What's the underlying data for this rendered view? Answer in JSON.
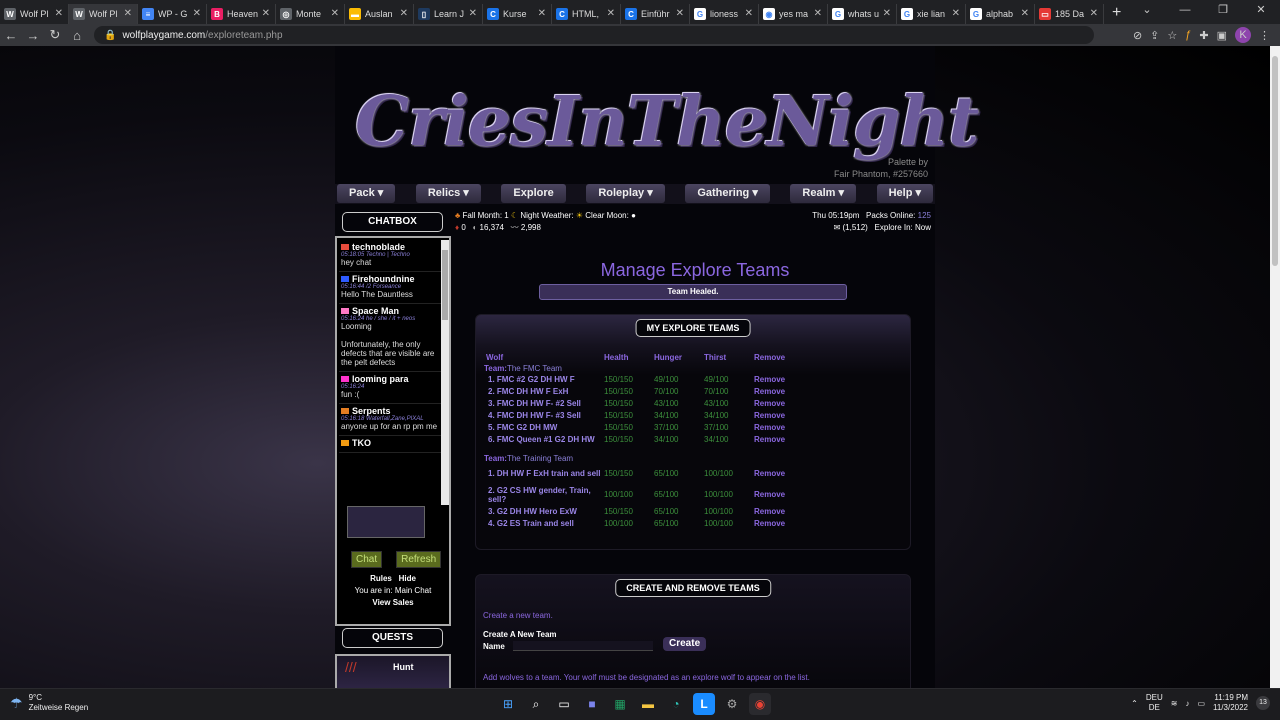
{
  "browser": {
    "tabs": [
      {
        "label": "Wolf Pl",
        "color": "#5f6368",
        "glyph": "W"
      },
      {
        "label": "Wolf Pl",
        "color": "#5f6368",
        "glyph": "W"
      },
      {
        "label": "WP - G",
        "color": "#4285f4",
        "glyph": "≡"
      },
      {
        "label": "Heaven",
        "color": "#e91e63",
        "glyph": "B"
      },
      {
        "label": "Monte",
        "color": "#5f6368",
        "glyph": "◎"
      },
      {
        "label": "Auslan",
        "color": "#fbbc04",
        "glyph": "▬"
      },
      {
        "label": "Learn J",
        "color": "#1e3a5f",
        "glyph": "▯"
      },
      {
        "label": "Kurse",
        "color": "#1a73e8",
        "glyph": "C"
      },
      {
        "label": "HTML,",
        "color": "#1a73e8",
        "glyph": "C"
      },
      {
        "label": "Einführ",
        "color": "#1a73e8",
        "glyph": "C"
      },
      {
        "label": "lioness",
        "color": "#ffffff",
        "glyph": "G"
      },
      {
        "label": "yes ma",
        "color": "#ffffff",
        "glyph": "◉"
      },
      {
        "label": "whats u",
        "color": "#ffffff",
        "glyph": "G"
      },
      {
        "label": "xie lian",
        "color": "#ffffff",
        "glyph": "G"
      },
      {
        "label": "alphab",
        "color": "#ffffff",
        "glyph": "G"
      },
      {
        "label": "185 Da",
        "color": "#e53935",
        "glyph": "▭"
      }
    ],
    "url_domain": "wolfplaygame.com",
    "url_path": "/exploreteam.php"
  },
  "site": {
    "logo": "CriesInTheNight",
    "palette_line1": "Palette by",
    "palette_line2": "Fair Phantom, #257660",
    "nav": [
      "Pack ▾",
      "Relics ▾",
      "Explore",
      "Roleplay ▾",
      "Gathering ▾",
      "Realm ▾",
      "Help ▾"
    ]
  },
  "chat": {
    "title": "CHATBOX",
    "messages": [
      {
        "user": "technoblade",
        "meta": "05:18:05 Techno | Techno",
        "text": "hey chat",
        "flag": "#e74c3c"
      },
      {
        "user": "Firehoundnine",
        "meta": "05:16:44 /2 Forseance",
        "text": "Hello The Dauntless",
        "flag": "#2e5bff"
      },
      {
        "user": "Space Man",
        "meta": "05:16:24 he / she / it + neos",
        "text": "Looming\n\nUnfortunately, the only defects that are visible are the pelt defects",
        "flag": "#ff79c6"
      },
      {
        "user": "looming para",
        "meta": "05:16:24",
        "text": "fun :(",
        "flag": "#ff33cc"
      },
      {
        "user": "Serpents",
        "meta": "05:16:18 Waterfall,Zane,PIXAL",
        "text": "anyone up for an rp pm me",
        "flag": "#e67e22"
      },
      {
        "user": "TKO",
        "meta": "",
        "text": "",
        "flag": "#f39c12"
      }
    ],
    "chat_btn": "Chat",
    "refresh_btn": "Refresh",
    "rules": "Rules",
    "hide": "Hide",
    "you_are_in": "You are in: Main Chat",
    "view_sales": "View Sales"
  },
  "quests": {
    "title": "QUESTS",
    "item": "Hunt"
  },
  "status": {
    "season": "Fall Month: 1",
    "time": "Night",
    "weather_label": "Weather:",
    "weather": "Clear",
    "moon_label": "Moon:",
    "c1": "0",
    "c2": "16,374",
    "c3": "2,998",
    "datetime": "Thu 05:19pm",
    "packs_label": "Packs Online:",
    "packs": "125",
    "mail": "(1,512)",
    "explore_in": "Explore In: Now"
  },
  "page_title": "Manage Explore Teams",
  "healed": "Team Healed.",
  "teams_panel": {
    "title": "MY EXPLORE TEAMS",
    "headers": [
      "Wolf",
      "Health",
      "Hunger",
      "Thirst",
      "Remove"
    ],
    "team_label": "Team:",
    "teams": [
      {
        "name": "The FMC Team",
        "wolves": [
          {
            "name": "1. FMC #2 G2 DH HW F",
            "health": "150/150",
            "hunger": "49/100",
            "thirst": "49/100"
          },
          {
            "name": "2. FMC DH HW F ExH",
            "health": "150/150",
            "hunger": "70/100",
            "thirst": "70/100"
          },
          {
            "name": "3. FMC DH HW F- #2 Sell",
            "health": "150/150",
            "hunger": "43/100",
            "thirst": "43/100"
          },
          {
            "name": "4. FMC DH HW F- #3 Sell",
            "health": "150/150",
            "hunger": "34/100",
            "thirst": "34/100"
          },
          {
            "name": "5. FMC G2 DH MW",
            "health": "150/150",
            "hunger": "37/100",
            "thirst": "37/100"
          },
          {
            "name": "6. FMC Queen #1 G2 DH HW",
            "health": "150/150",
            "hunger": "34/100",
            "thirst": "34/100"
          }
        ]
      },
      {
        "name": "The Training Team",
        "wolves": [
          {
            "name": "1. DH HW F ExH train and sell",
            "health": "150/150",
            "hunger": "65/100",
            "thirst": "100/100"
          },
          {
            "name": "2. G2 CS HW gender, Train, sell?",
            "health": "100/100",
            "hunger": "65/100",
            "thirst": "100/100"
          },
          {
            "name": "3. G2 DH HW Hero ExW",
            "health": "150/150",
            "hunger": "65/100",
            "thirst": "100/100"
          },
          {
            "name": "4. G2 ES Train and sell",
            "health": "100/100",
            "hunger": "65/100",
            "thirst": "100/100"
          }
        ]
      }
    ],
    "remove": "Remove"
  },
  "create_panel": {
    "title": "CREATE AND REMOVE TEAMS",
    "create_link": "Create a new team.",
    "create_heading": "Create A New Team",
    "name_label": "Name",
    "create_btn": "Create",
    "add_note": "Add wolves to a team. Your wolf must be designated as an explore wolf to appear on the list."
  },
  "taskbar": {
    "temp": "9°C",
    "weather": "Zeitweise Regen",
    "lang1": "DEU",
    "lang2": "DE",
    "time": "11:19 PM",
    "date": "11/3/2022",
    "notif": "13"
  }
}
